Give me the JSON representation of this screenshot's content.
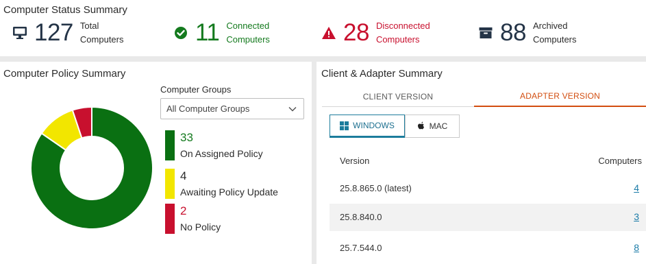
{
  "status": {
    "title": "Computer Status Summary",
    "total": {
      "icon": "monitor-icon",
      "count": "127",
      "line1": "Total",
      "line2": "Computers"
    },
    "connected": {
      "icon": "check-circle-icon",
      "count": "11",
      "line1": "Connected",
      "line2": "Computers",
      "color": "#147a1e"
    },
    "disconnected": {
      "icon": "warning-icon",
      "count": "28",
      "line1": "Disconnected",
      "line2": "Computers",
      "color": "#c8102e"
    },
    "archived": {
      "icon": "archive-box-icon",
      "count": "88",
      "line1": "Archived",
      "line2": "Computers"
    }
  },
  "policy": {
    "title": "Computer Policy Summary",
    "groups_label": "Computer Groups",
    "groups_selected": "All Computer Groups",
    "legend": [
      {
        "count": "33",
        "label": "On Assigned Policy",
        "color": "#0a7012"
      },
      {
        "count": "4",
        "label": "Awaiting Policy Update",
        "color": "#f2e600"
      },
      {
        "count": "2",
        "label": "No Policy",
        "color": "#c8102e"
      }
    ],
    "donut_values": [
      33,
      4,
      2
    ]
  },
  "client": {
    "title": "Client & Adapter Summary",
    "tabs": [
      {
        "label": "CLIENT VERSION",
        "active": false
      },
      {
        "label": "ADAPTER VERSION",
        "active": true
      }
    ],
    "os_buttons": [
      {
        "label": "WINDOWS",
        "icon": "windows-icon",
        "active": true
      },
      {
        "label": "MAC",
        "icon": "apple-icon",
        "active": false
      }
    ],
    "columns": {
      "version": "Version",
      "computers": "Computers"
    },
    "rows": [
      {
        "version": "25.8.865.0 (latest)",
        "computers": "4"
      },
      {
        "version": "25.8.840.0",
        "computers": "3"
      },
      {
        "version": "25.7.544.0",
        "computers": "8"
      }
    ]
  }
}
